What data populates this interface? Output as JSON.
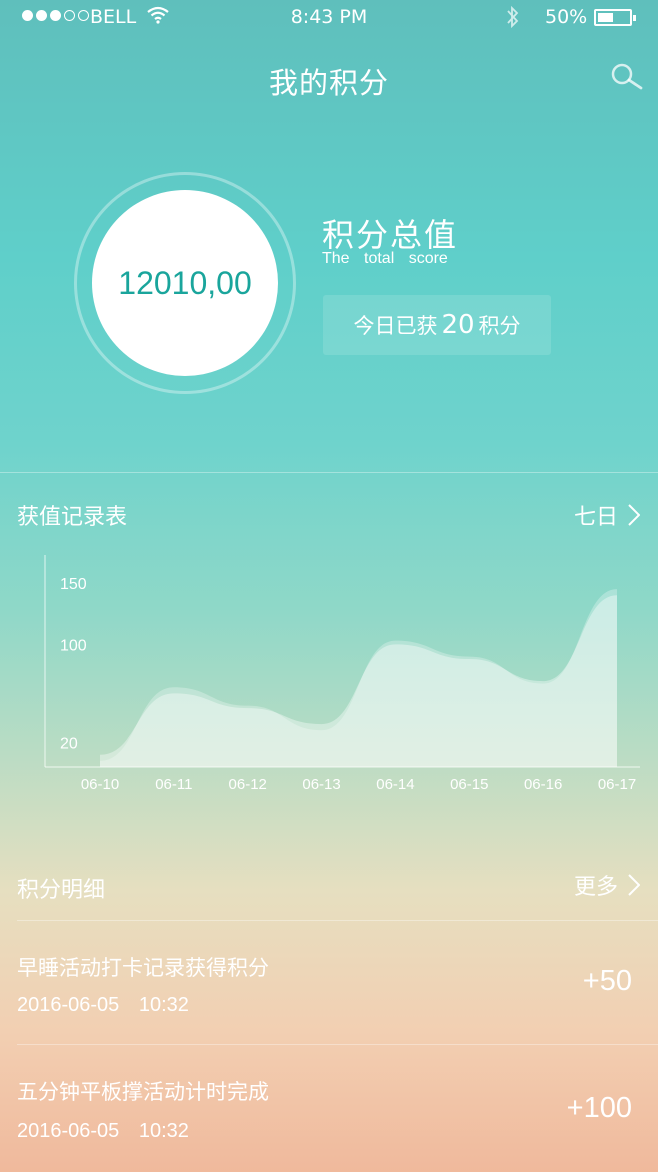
{
  "status_bar": {
    "signal_filled": 3,
    "signal_total": 5,
    "carrier": "BELL",
    "time": "8:43 PM",
    "battery": "50%",
    "battery_level": 0.5
  },
  "header": {
    "title": "我的积分",
    "search_icon": "search-icon"
  },
  "score": {
    "value": "12010,00",
    "label": "积分总值",
    "sublabel": "The total score",
    "today_prefix": "今日已获",
    "today_value": "20",
    "today_suffix": "积分"
  },
  "history": {
    "title": "获值记录表",
    "range_label": "七日"
  },
  "chart_data": {
    "type": "area",
    "title": "",
    "xlabel": "",
    "ylabel": "",
    "x": [
      "06-10",
      "06-11",
      "06-12",
      "06-13",
      "06-14",
      "06-15",
      "06-16",
      "06-17"
    ],
    "yticks": [
      "150",
      "100",
      "20"
    ],
    "series": [
      {
        "values": [
          5,
          65,
          50,
          30,
          103,
          90,
          68,
          145
        ]
      },
      {
        "values": [
          10,
          60,
          48,
          35,
          100,
          88,
          70,
          140
        ]
      }
    ],
    "accent": "#ffffff"
  },
  "records": {
    "title": "积分明细",
    "more_label": "更多",
    "items": [
      {
        "title": "早睡活动打卡记录获得积分",
        "time": "2016-06-05 10:32",
        "points": "+50"
      },
      {
        "title": "五分钟平板撑活动计时完成",
        "time": "2016-06-05 10:32",
        "points": "+100"
      }
    ]
  },
  "colors": {
    "teal": "#5fcfca",
    "score_text": "#1aa59c",
    "peach": "#f0b99c"
  }
}
